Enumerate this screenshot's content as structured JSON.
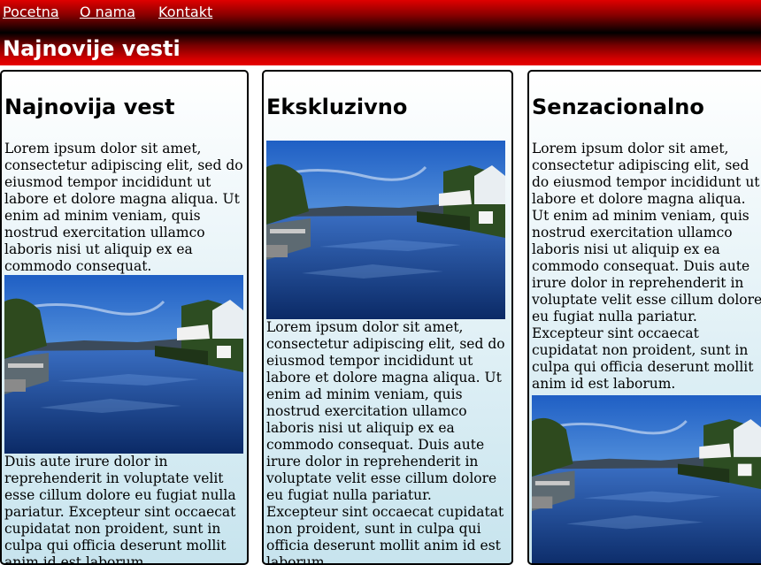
{
  "nav": {
    "items": [
      "Pocetna",
      "O nama",
      "Kontakt"
    ]
  },
  "banner": {
    "title": "Najnovije vesti"
  },
  "columns": [
    {
      "heading": "Najnovija vest",
      "text_before": "Lorem ipsum dolor sit amet, consectetur adipiscing elit, sed do eiusmod tempor incididunt ut labore et dolore magna aliqua. Ut enim ad minim veniam, quis nostrud exercitation ullamco laboris nisi ut aliquip ex ea commodo consequat.",
      "text_after": "Duis aute irure dolor in reprehenderit in voluptate velit esse cillum dolore eu fugiat nulla pariatur. Excepteur sint occaecat cupidatat non proident, sunt in culpa qui officia deserunt mollit anim id est laborum."
    },
    {
      "heading": "Ekskluzivno",
      "text_after": "Lorem ipsum dolor sit amet, consectetur adipiscing elit, sed do eiusmod tempor incididunt ut labore et dolore magna aliqua. Ut enim ad minim veniam, quis nostrud exercitation ullamco laboris nisi ut aliquip ex ea commodo consequat. Duis aute irure dolor in reprehenderit in voluptate velit esse cillum dolore eu fugiat nulla pariatur. Excepteur sint occaecat cupidatat non proident, sunt in culpa qui officia deserunt mollit anim id est laborum."
    },
    {
      "heading": "Senzacionalno",
      "text_before": "Lorem ipsum dolor sit amet, consectetur adipiscing elit, sed do eiusmod tempor incididunt ut labore et dolore magna aliqua. Ut enim ad minim veniam, quis nostrud exercitation ullamco laboris nisi ut aliquip ex ea commodo consequat. Duis aute irure dolor in reprehenderit in voluptate velit esse cillum dolore eu fugiat nulla pariatur. Excepteur sint occaecat cupidatat non proident, sunt in culpa qui officia deserunt mollit anim id est laborum."
    }
  ],
  "colors": {
    "nav_top": "#e00000",
    "banner_bottom": "#e60000",
    "column_gradient_end": "#c7e4ee"
  }
}
